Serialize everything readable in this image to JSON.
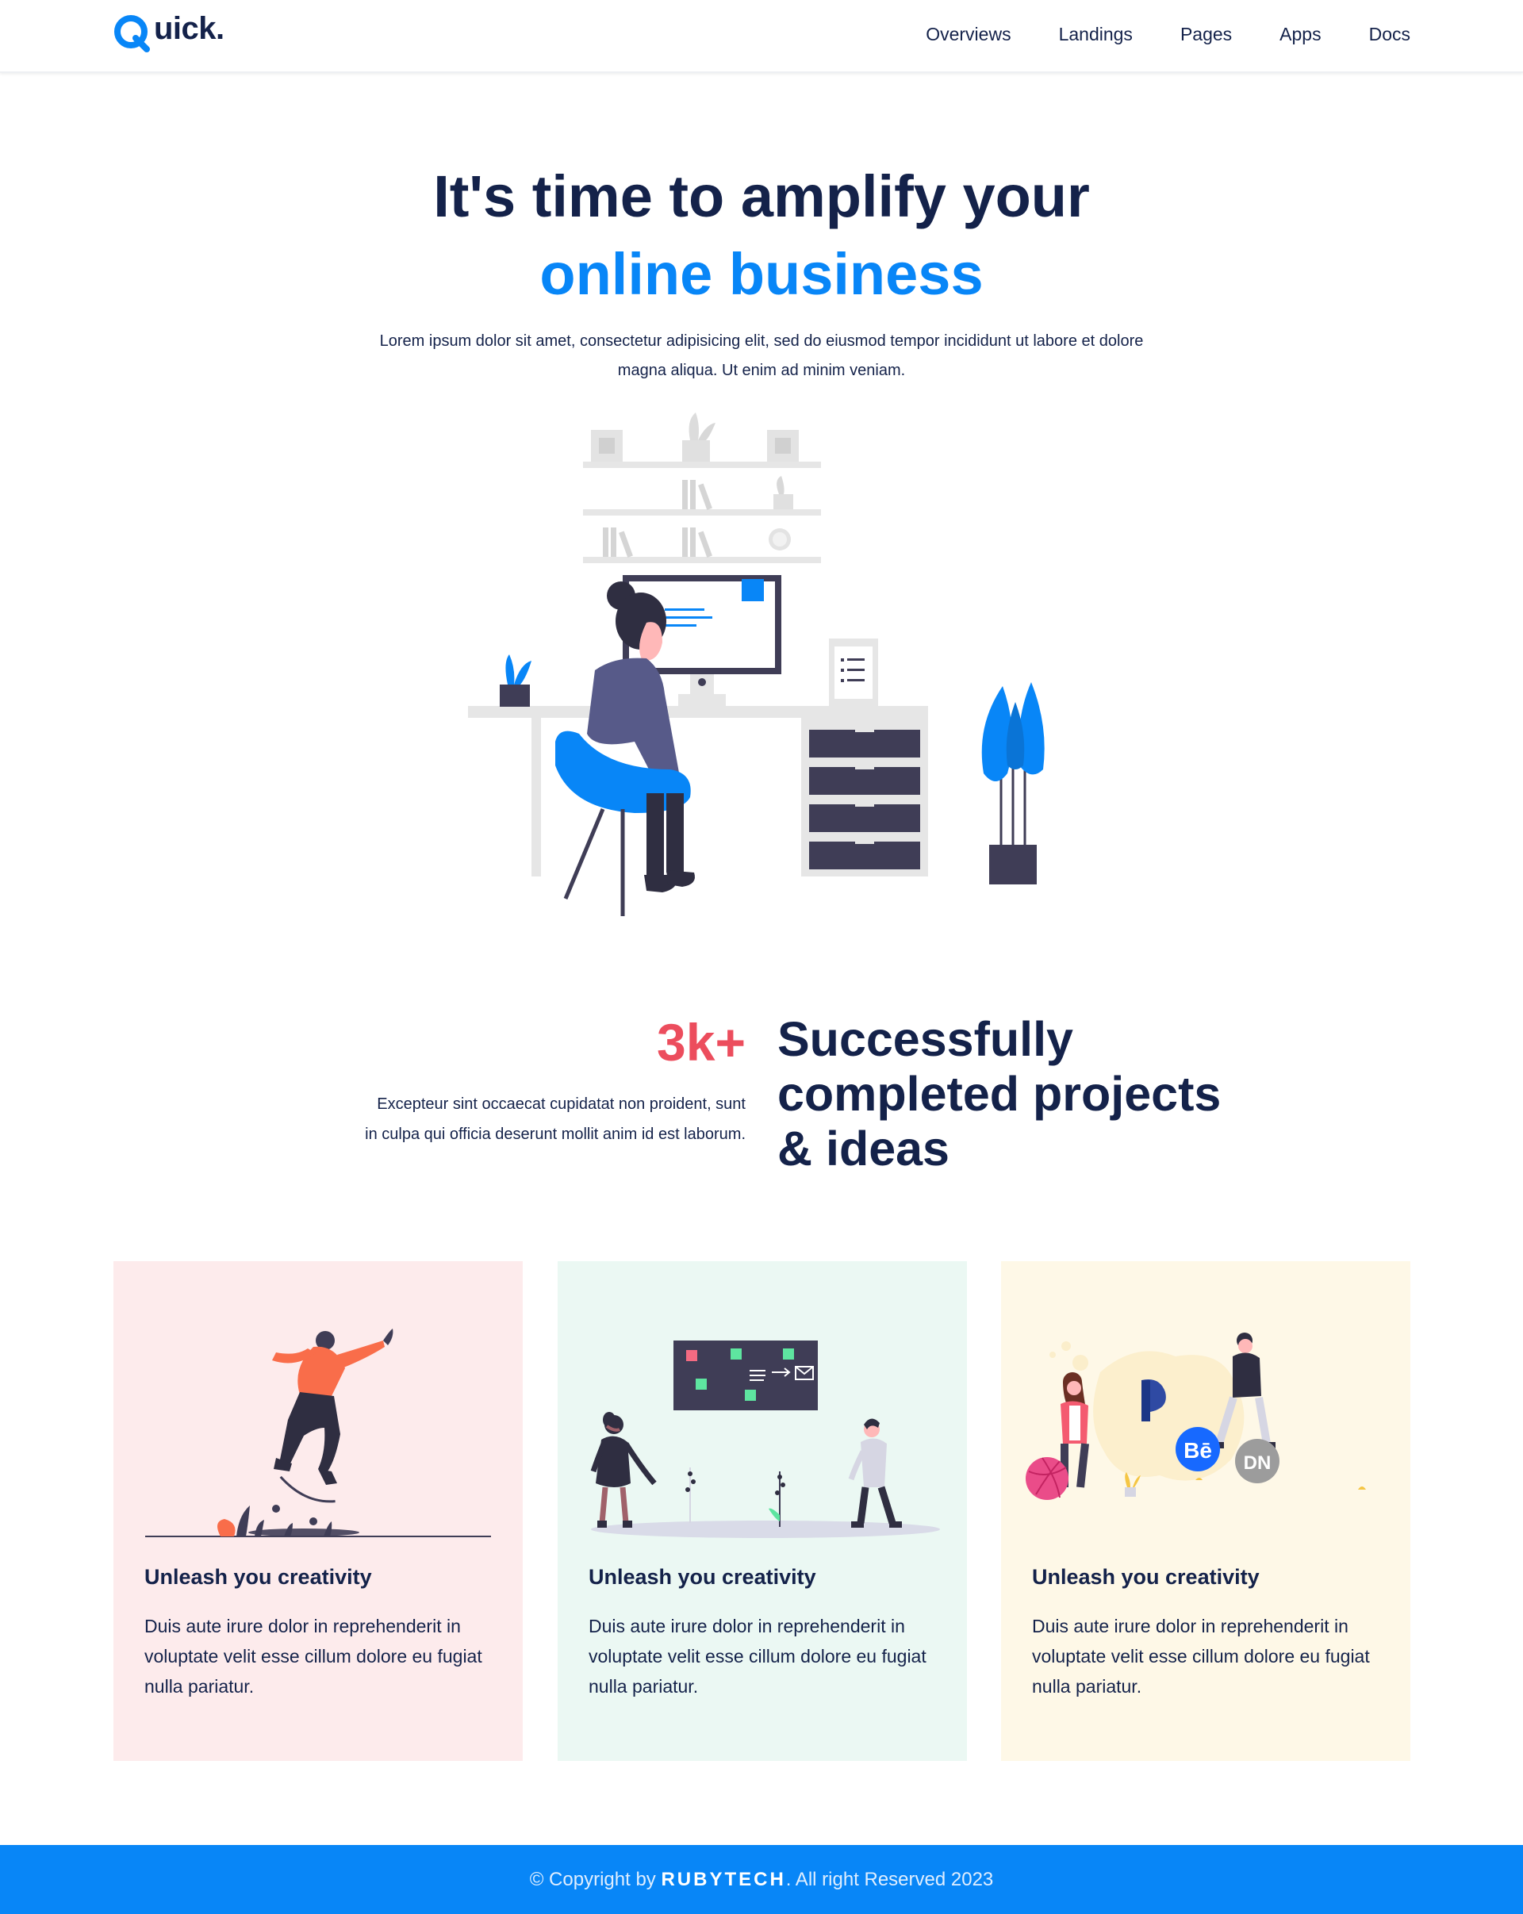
{
  "navbar": {
    "logo": {
      "initial": "Q",
      "rest": "uick",
      "dot": "."
    },
    "links": [
      "Overviews",
      "Landings",
      "Pages",
      "Apps",
      "Docs"
    ]
  },
  "hero": {
    "line1": "It's time to amplify your",
    "line2": "online business",
    "text": "Lorem ipsum dolor sit amet, consectetur adipisicing elit, sed do eiusmod tempor incididunt ut labore et dolore magna aliqua. Ut enim ad minim veniam."
  },
  "stats": {
    "number": "3k+",
    "text": "Excepteur sint occaecat cupidatat non proident, sunt in culpa qui officia deserunt mollit anim id est laborum.",
    "heading": "Successfully completed projects & ideas"
  },
  "cards": [
    {
      "title": "Unleash you creativity",
      "text": "Duis aute irure dolor in reprehenderit in voluptate velit esse cillum dolore eu fugiat nulla pariatur."
    },
    {
      "title": "Unleash you creativity",
      "text": "Duis aute irure dolor in reprehenderit in voluptate velit esse cillum dolore eu fugiat nulla pariatur."
    },
    {
      "title": "Unleash you creativity",
      "text": "Duis aute irure dolor in reprehenderit in voluptate velit esse cillum dolore eu fugiat nulla pariatur."
    }
  ],
  "footer": {
    "prefix": "© Copyright by ",
    "brand": "RUBYTECH",
    "suffix": ". All right Reserved 2023"
  },
  "colors": {
    "primary": "#0886f7",
    "navy": "#14224a",
    "accent_red": "#ec4d5d",
    "card_pink": "#fdebec",
    "card_mint": "#ebf8f3",
    "card_cream": "#fef8e7"
  },
  "icons": [
    "logo-q-icon",
    "workspace-illustration",
    "skater-illustration",
    "presentation-illustration",
    "social-illustration",
    "behance-icon",
    "dribbble-icon",
    "product-hunt-icon",
    "dn-icon"
  ],
  "illustration_labels": {
    "behance": "Bē",
    "dn": "DN"
  }
}
